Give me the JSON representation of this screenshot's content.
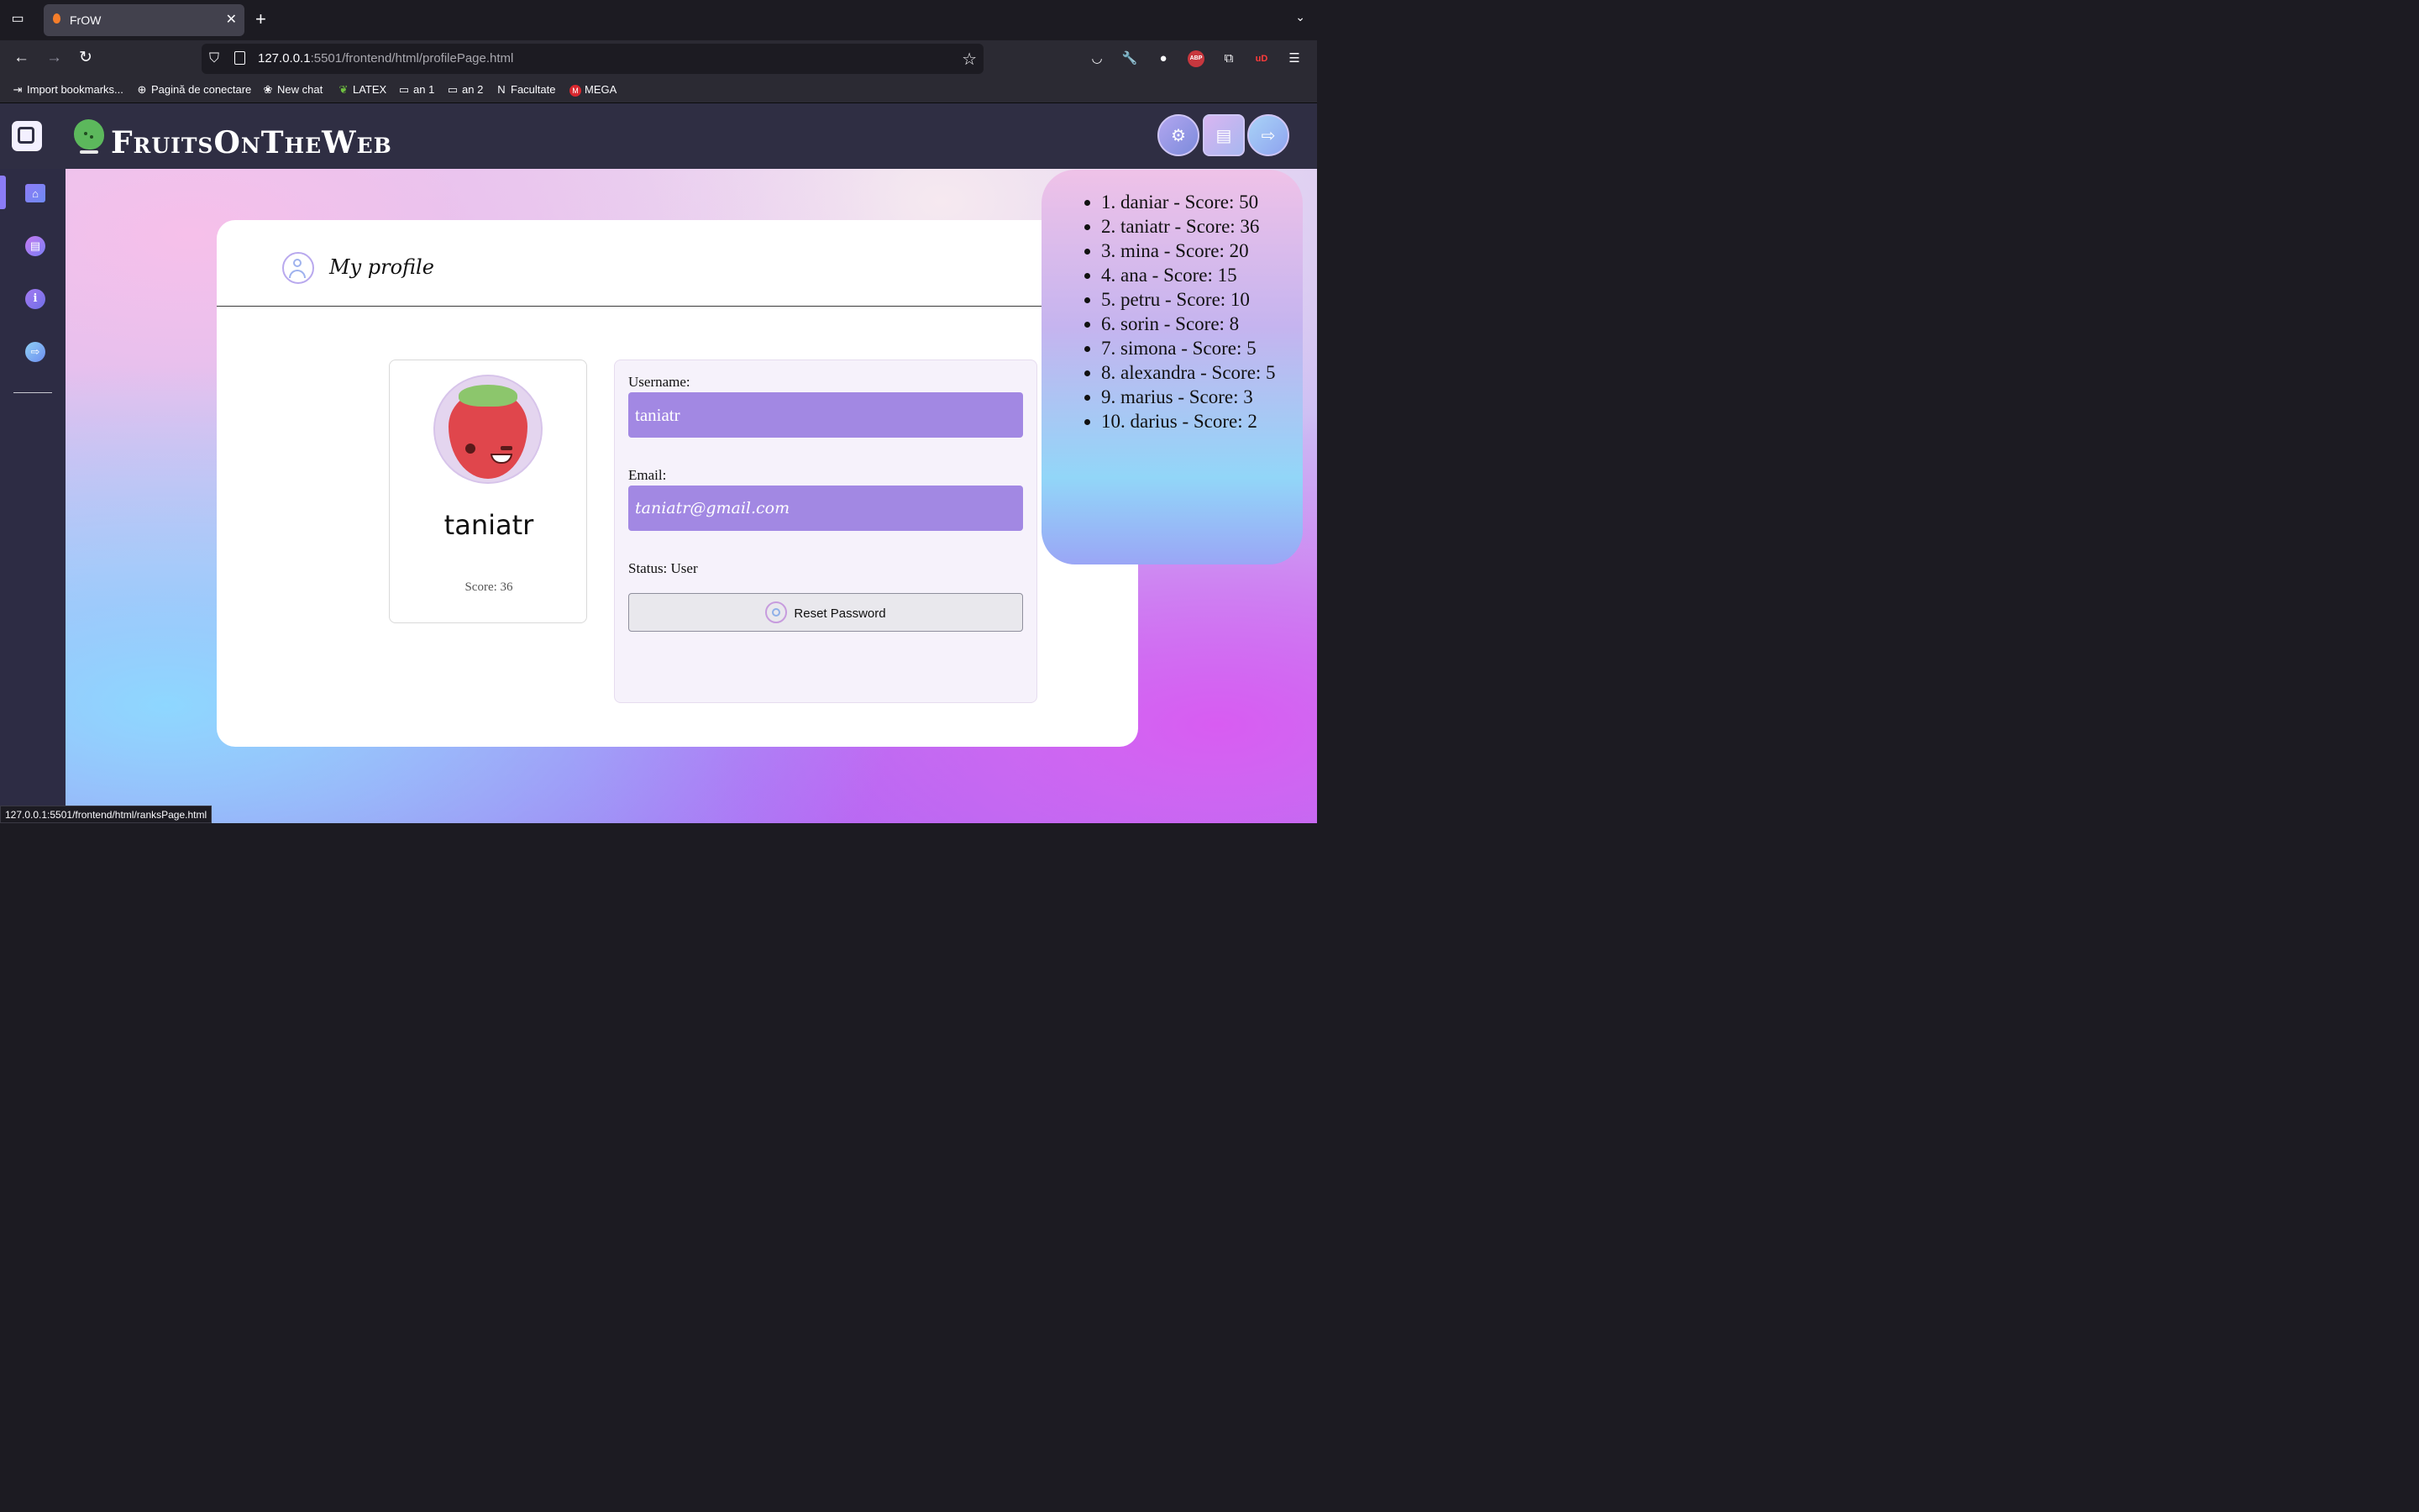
{
  "browser": {
    "tab_title": "FrOW",
    "url_host": "127.0.0.1",
    "url_rest": ":5501/frontend/html/profilePage.html",
    "status_link": "127.0.0.1:5501/frontend/html/ranksPage.html",
    "bookmarks": [
      "Import bookmarks...",
      "Pagină de conectare",
      "New chat",
      "LATEX",
      "an 1",
      "an 2",
      "Facultate",
      "MEGA"
    ],
    "extensions": {
      "abp": "ABP",
      "ublock": "uD"
    }
  },
  "app": {
    "brand": "FruitsOnTheWeb",
    "header_buttons": [
      "settings-icon",
      "contact-card-icon",
      "logout-icon"
    ],
    "sidebar": [
      "home-icon",
      "book-icon",
      "info-icon",
      "exit-icon"
    ]
  },
  "profile": {
    "title": "My profile",
    "avatar_name": "taniatr",
    "score_text": "Score: 36",
    "username_label": "Username:",
    "username_value": "taniatr",
    "email_label": "Email:",
    "email_value": "taniatr@gmail.com",
    "status_text": "Status: User",
    "reset_label": "Reset Password"
  },
  "leaderboard": [
    "1. daniar - Score: 50",
    "2. taniatr - Score: 36",
    "3. mina - Score: 20",
    "4. ana - Score: 15",
    "5. petru - Score: 10",
    "6. sorin - Score: 8",
    "7. simona - Score: 5",
    "8. alexandra - Score: 5",
    "9. marius - Score: 3",
    "10. darius - Score: 2"
  ],
  "colors": {
    "accent": "#a288e3",
    "header": "#2f2e43",
    "sidebar": "#2d2c44"
  }
}
